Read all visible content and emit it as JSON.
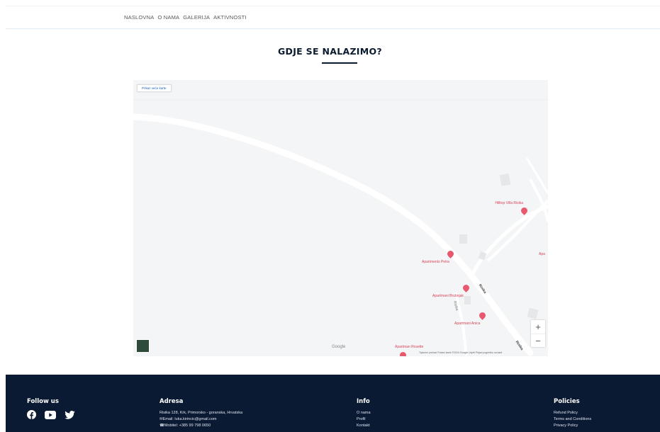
{
  "nav": {
    "items": [
      "NASLOVNA",
      "O NAMA",
      "GALERIJA",
      "AKTIVNOSTI"
    ]
  },
  "section": {
    "title": "GDJE SE NALAZIMO?"
  },
  "map": {
    "larger_map_link": "Prikaz veće karte",
    "pois": [
      {
        "name": "Hilltop Villa Risika"
      },
      {
        "name": "Apartments Petra"
      },
      {
        "name": "Apartmani Brubnjak"
      },
      {
        "name": "Apartmani Anica"
      },
      {
        "name": "Apartman Rosette"
      },
      {
        "name": "Apa"
      }
    ],
    "road_labels": [
      "Risika",
      "Risika",
      "Risika"
    ],
    "zoom_in": "+",
    "zoom_out": "−",
    "google_logo": "Google",
    "attribution": "Tipkovni prečaci   Podaci karte ©2024 Google   Uvjeti   Prijavi pogrešku na karti",
    "colors": {
      "poi": "#e8596f",
      "road": "#ffffff",
      "land": "#f4f5f6"
    }
  },
  "footer": {
    "follow": {
      "title": "Follow us",
      "icons": [
        "facebook-icon",
        "youtube-icon",
        "twitter-icon"
      ]
    },
    "address": {
      "title": "Adresa",
      "lines": [
        "Risika 128, Krk, Primorsko - goranska, Hrvatska",
        "✉Email: luka.kirincic@gmail.com",
        "☎Mobitel: +385 99 798 0650"
      ]
    },
    "info": {
      "title": "Info",
      "links": [
        "O nama",
        "Profil",
        "Kontakt"
      ]
    },
    "policies": {
      "title": "Policies",
      "links": [
        "Refund Policy",
        "Terms and Conditions",
        "Privacy Policy"
      ]
    },
    "background": "#0b1a33"
  }
}
